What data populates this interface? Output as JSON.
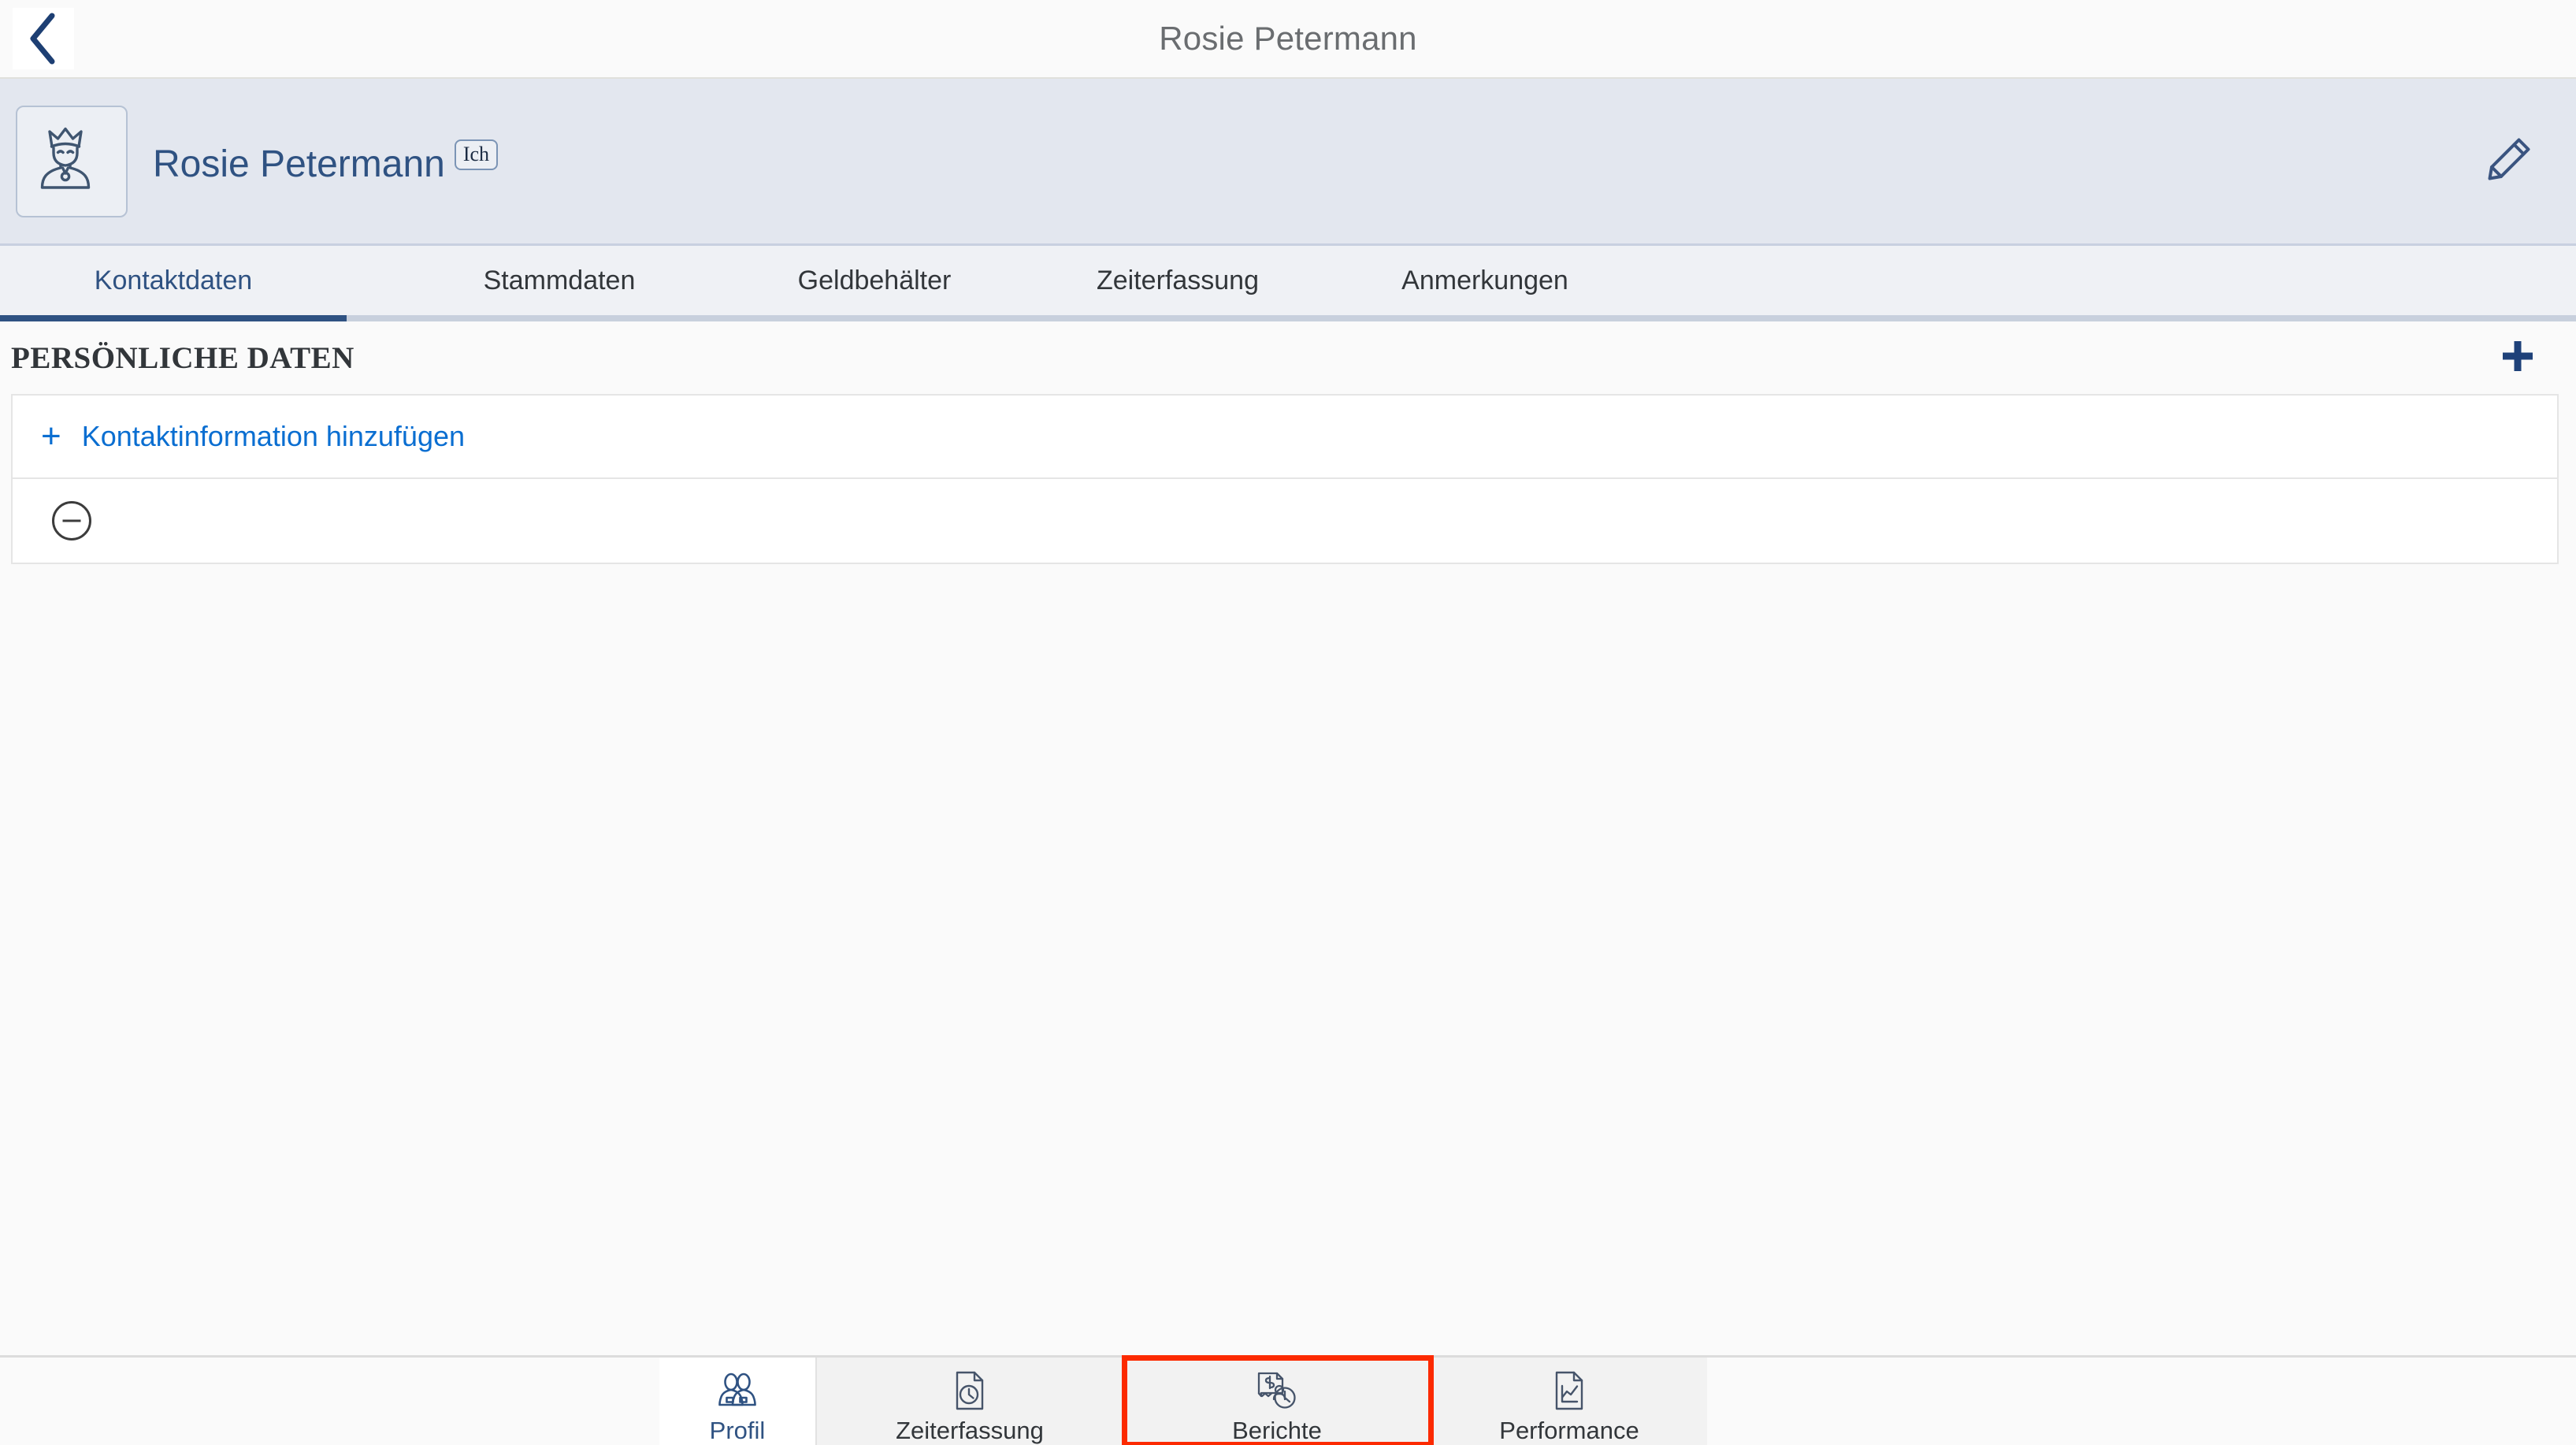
{
  "titlebar": {
    "back_icon": "chevron-left-icon",
    "title": "Rosie Petermann"
  },
  "profile_header": {
    "avatar_icon": "crowned-person-avatar-icon",
    "name": "Rosie Petermann",
    "badge": "Ich",
    "edit_icon": "pencil-edit-icon"
  },
  "tabs": [
    {
      "label": "Kontaktdaten",
      "active": true
    },
    {
      "label": "Stammdaten",
      "active": false
    },
    {
      "label": "Geldbehälter",
      "active": false
    },
    {
      "label": "Zeiterfassung",
      "active": false
    },
    {
      "label": "Anmerkungen",
      "active": false
    }
  ],
  "section": {
    "title": "PERSÖNLICHE DATEN",
    "add_icon": "plus-icon"
  },
  "cards": [
    {
      "type": "add-link",
      "plus": "+",
      "label": "Kontaktinformation hinzufügen"
    },
    {
      "type": "remove-row",
      "icon": "circle-minus-icon"
    }
  ],
  "bottom_nav": [
    {
      "label": "Profil",
      "icon": "two-people-icon",
      "active": true,
      "highlighted": false
    },
    {
      "label": "Zeiterfassung",
      "icon": "document-clock-icon",
      "active": false,
      "highlighted": false
    },
    {
      "label": "Berichte",
      "icon": "invoice-person-clock-icon",
      "active": false,
      "highlighted": true
    },
    {
      "label": "Performance",
      "icon": "document-chart-icon",
      "active": false,
      "highlighted": false
    }
  ],
  "colors": {
    "brand_dark_blue": "#2f5282",
    "link_blue": "#0a6ed1",
    "highlight_red": "#fc2a00",
    "header_bg": "#e3e7ef",
    "tabbar_bg": "#eff1f5",
    "page_bg": "#fafafa",
    "nav_bg": "#f2f2f2",
    "title_gray": "#6a6d70"
  }
}
